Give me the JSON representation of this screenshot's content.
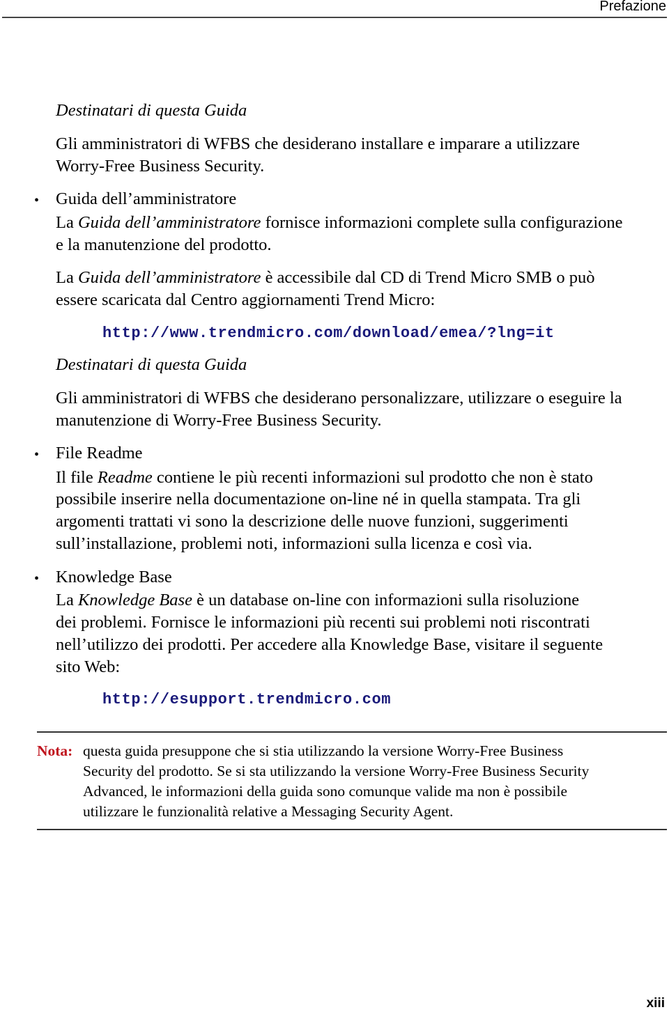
{
  "header": {
    "section_title": "Prefazione"
  },
  "blocks": {
    "audience1_title": "Destinatari di questa Guida",
    "audience1_text_l1": "Gli amministratori di WFBS che desiderano installare e imparare a utilizzare",
    "audience1_text_l2": "Worry-Free Business Security.",
    "admin_guide": {
      "title": "Guida dell’amministratore",
      "l1_prefix": "La ",
      "l1_italic": "Guida dell’amministratore",
      "l1_suffix": " fornisce informazioni complete sulla configurazione",
      "l2": "e la manutenzione del prodotto.",
      "p2_l1_prefix": "La ",
      "p2_l1_italic": "Guida dell’amministratore",
      "p2_l1_suffix": " è accessibile dal CD di Trend Micro SMB o può",
      "p2_l2": "essere scaricata dal Centro aggiornamenti Trend Micro:",
      "url": "http://www.trendmicro.com/download/emea/?lng=it"
    },
    "audience2_title": "Destinatari di questa Guida",
    "audience2_text_l1": "Gli amministratori di WFBS che desiderano personalizzare, utilizzare o eseguire la",
    "audience2_text_l2": "manutenzione di Worry-Free Business Security.",
    "readme": {
      "title": "File Readme",
      "l1_prefix": "Il file ",
      "l1_italic": "Readme",
      "l1_suffix": " contiene le più recenti informazioni sul prodotto che non è stato",
      "l2": "possibile inserire nella documentazione on-line né in quella stampata. Tra gli",
      "l3": "argomenti trattati vi sono la descrizione delle nuove funzioni, suggerimenti",
      "l4": "sull’installazione, problemi noti, informazioni sulla licenza e così via."
    },
    "kb": {
      "title": "Knowledge Base",
      "l1_prefix": "La ",
      "l1_italic": "Knowledge Base",
      "l1_suffix": " è un database on-line con informazioni sulla risoluzione",
      "l2": "dei problemi. Fornisce le informazioni più recenti sui problemi noti riscontrati",
      "l3": "nell’utilizzo dei prodotti. Per accedere alla Knowledge Base, visitare il seguente",
      "l4": "sito Web:",
      "url": "http://esupport.trendmicro.com"
    },
    "note": {
      "label": "Nota:",
      "l1": "questa guida presuppone che si stia utilizzando la versione Worry-Free Business",
      "l2": "Security del prodotto. Se si sta utilizzando la versione Worry-Free Business Security",
      "l3": "Advanced, le informazioni della guida sono comunque valide ma non è possibile",
      "l4": "utilizzare le funzionalità relative a Messaging Security Agent."
    }
  },
  "bullet_char": "•",
  "footer": {
    "page_number": "xiii"
  }
}
